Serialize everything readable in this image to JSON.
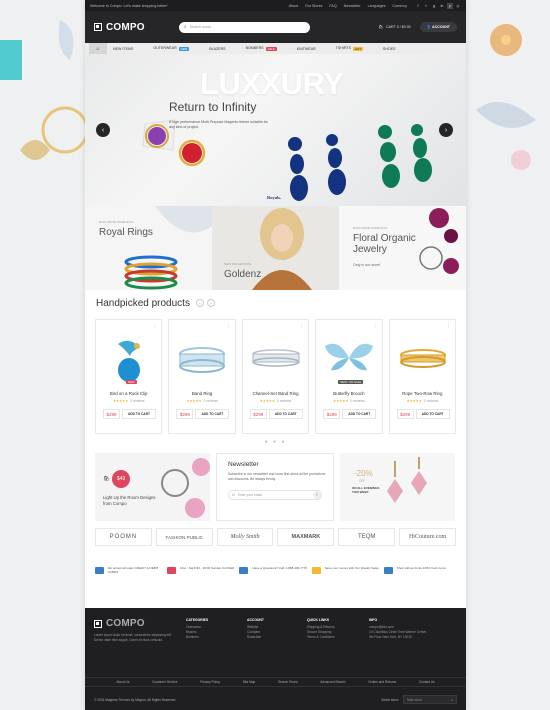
{
  "topbar": {
    "welcome": "Welcome to Compo. Let's make shopping better!",
    "links": [
      "About",
      "Our Stores",
      "FAQ",
      "Newsletter",
      "Languages",
      "Currency"
    ],
    "social": [
      "f",
      "t",
      "g",
      "in",
      "p",
      "◎"
    ]
  },
  "header": {
    "logo": "COMPO",
    "search_placeholder": "Search some...",
    "cart": "CART 0 / $0.00",
    "account": "ACCOUNT"
  },
  "nav": {
    "items": [
      "NEW ITEMS",
      "OUTERWEAR",
      "BLAZERS",
      "BOMBERS",
      "KNITWEAR",
      "TSHIRTS",
      "SHOES"
    ],
    "badges": {
      "outerwear": "NEW",
      "bombers": "SALE",
      "tshirts": "HOT"
    }
  },
  "hero": {
    "headline": "LUXXURY",
    "subtitle": "Return to Infinity",
    "desc": "A high performance Multi-Purpose Magento theme suitable for any kind of project.",
    "brand": "Royals."
  },
  "promos": [
    {
      "kicker": "Exclusive products",
      "title": "Royal Rings"
    },
    {
      "kicker": "New collection",
      "title": "Goldenz"
    },
    {
      "kicker": "Exclusive products",
      "title": "Floral Organic Jewelry",
      "sub": "Only in our store!"
    }
  ],
  "handpicked": {
    "title": "Handpicked products"
  },
  "products": [
    {
      "name": "Bird on a Rock Clip",
      "price": "$299",
      "reviews": "0 reviews",
      "badge": "NEW",
      "cta": "ADD TO CART"
    },
    {
      "name": "Band Ring",
      "price": "$299",
      "reviews": "0 reviews",
      "badge": "",
      "cta": "ADD TO CART"
    },
    {
      "name": "Channel-Set Band Ring",
      "price": "$299",
      "reviews": "0 reviews",
      "badge": "",
      "cta": "ADD TO CART"
    },
    {
      "name": "Butterfly Brooch",
      "price": "$299",
      "reviews": "0 reviews",
      "badge": "NEW / ON SALE",
      "cta": "ADD TO CART"
    },
    {
      "name": "Rope Two-Row Ring",
      "price": "$299",
      "reviews": "0 reviews",
      "badge": "",
      "cta": "ADD TO CART"
    }
  ],
  "banner_left": {
    "price": "$49",
    "text": "Light Up the Room Designs from Compo"
  },
  "newsletter": {
    "title": "Newsletter",
    "text": "Subscribe to our newsletter and know first about all the promotions and discounts. Be always trendy.",
    "placeholder": "Enter your email"
  },
  "banner_right": {
    "pct": "-20%",
    "off": "OFF",
    "text": "ON ALL EVENINGS THIS WEEK"
  },
  "brands": [
    "POOMN",
    "FASHION·PUBLIC",
    "Molly Smith",
    "MAXMARK",
    "TEQM",
    "HiCouture.com"
  ],
  "features": [
    "We accept all major CREDIT & DEBIT CARDS",
    "Mon - Sat 8:30 - 18:00 Sunday CLOSED",
    "Have a Questions? Call: 1-888-496-7778",
    "Save your money with Our Weekly Sales",
    "Shop without limits 100% fresh items"
  ],
  "footer": {
    "logo": "COMPO",
    "about": "Lorem ipsum dolor sit amet, consectetur adipiscing elit. Donec vitae nibh augue. Donec id risus vehicula.",
    "categories": {
      "title": "CATEGORIES",
      "items": [
        "Outerwear",
        "Blazers",
        "Bombers"
      ]
    },
    "account": {
      "title": "ACCOUNT",
      "items": [
        "Wishlist",
        "Compare",
        "Subscribe"
      ]
    },
    "quick": {
      "title": "QUICK LINKS",
      "items": [
        "Shipping & Returns",
        "Secure Shopping",
        "Terms & Conditions"
      ]
    },
    "info": {
      "title": "INFO",
      "items": [
        "compo@info.com",
        "10 Columbus Circle Time Warner Center,",
        "4th Floor New York, NY 10019"
      ]
    },
    "links": [
      "About Us",
      "Customer Service",
      "Privacy Policy",
      "Site Map",
      "Search Terms",
      "Advanced Search",
      "Orders and Returns",
      "Contact Us"
    ],
    "copyright": "© 2016 Magento Themes by Megnor. All Rights Reserved.",
    "store_label": "Select store:",
    "store_value": "Main store"
  }
}
